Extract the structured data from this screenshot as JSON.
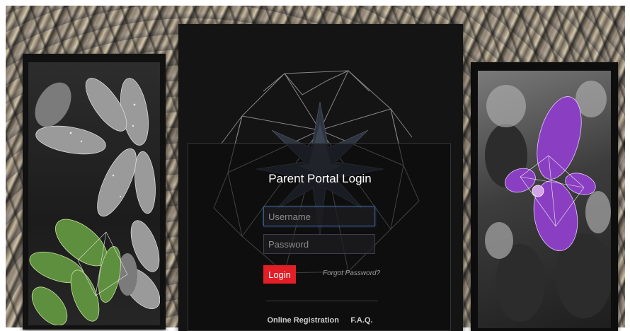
{
  "login": {
    "title": "Parent Portal Login",
    "username_placeholder": "Username",
    "password_placeholder": "Password",
    "login_label": "Login",
    "forgot_label": "Forgot Password?"
  },
  "footer": {
    "registration_label": "Online Registration",
    "faq_label": "F.A.Q."
  },
  "colors": {
    "login_button": "#e21f26",
    "panel_dark": "#141414",
    "orchid_accent": "#8a3fc2"
  }
}
